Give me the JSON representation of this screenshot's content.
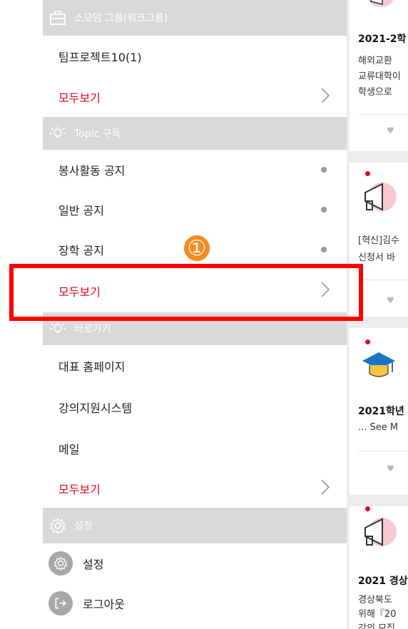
{
  "sections": {
    "group": {
      "header": "소모임 그룹(워크그룹)",
      "items": [
        "팀프로젝트10(1)"
      ],
      "view_all": "모두보기"
    },
    "topic": {
      "header": "Topic 구독",
      "items": [
        "봉사활동 공지",
        "일반 공지",
        "장학 공지"
      ],
      "view_all": "모두보기"
    },
    "shortcut": {
      "header": "바로가기",
      "items": [
        "대표 홈페이지",
        "강의지원시스템",
        "메일"
      ],
      "view_all": "모두보기"
    },
    "settings": {
      "header": "설정",
      "items": [
        "설정",
        "로그아웃"
      ]
    }
  },
  "annotation": {
    "badge": "①"
  },
  "feed": {
    "card1": {
      "title": "2021-2학",
      "lines": [
        "해외교환",
        "교류대학이",
        "학생으로"
      ]
    },
    "card2": {
      "lines": [
        "[혁신]김수",
        "신청서 바"
      ]
    },
    "card3": {
      "title": "2021학년",
      "lines": [
        "... See M"
      ]
    },
    "card4": {
      "title": "2021 경상",
      "lines": [
        "경상북도",
        "위해『20",
        "강의 모집"
      ]
    }
  },
  "colors": {
    "accent": "#e5001c",
    "header_bg": "#d9d9d9",
    "highlight": "#ff0000",
    "badge": "#f68b1e"
  }
}
